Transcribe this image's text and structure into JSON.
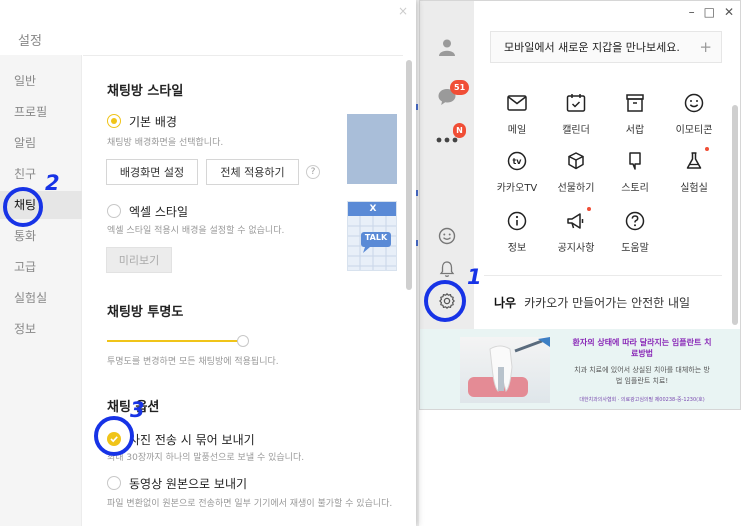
{
  "kakao": {
    "window_controls": [
      "–",
      "□",
      "✕"
    ],
    "sidebar": {
      "chat_badge": "51",
      "more_badge": "N"
    },
    "notice": "모바일에서 새로운 지갑을 만나보세요.",
    "notice_plus": "+",
    "grid": [
      {
        "label": "메일",
        "icon": "mail-icon"
      },
      {
        "label": "캘린더",
        "icon": "calendar-icon"
      },
      {
        "label": "서랍",
        "icon": "drawer-icon"
      },
      {
        "label": "이모티콘",
        "icon": "emoticon-icon"
      },
      {
        "label": "카카오TV",
        "icon": "tv-icon"
      },
      {
        "label": "선물하기",
        "icon": "gift-icon"
      },
      {
        "label": "스토리",
        "icon": "story-icon"
      },
      {
        "label": "실험실",
        "icon": "flask-icon"
      },
      {
        "label": "정보",
        "icon": "info-icon"
      },
      {
        "label": "공지사항",
        "icon": "megaphone-icon"
      },
      {
        "label": "도움말",
        "icon": "help-icon"
      }
    ],
    "footer_bold": "나우",
    "footer_text": "카카오가 만들어가는 안전한 내일",
    "ad": {
      "title": "환자의 상태에 따라 달라지는 임플란트 치료방법",
      "sub": "치과 치료에 있어서 상실된 치아를 대체하는 방법 임플란트 치료!",
      "small": "대한치과의사협회 · 의료광고심의필 제00238-중-1230(호)"
    }
  },
  "settings": {
    "close": "×",
    "title": "설정",
    "nav": [
      "일반",
      "프로필",
      "알림",
      "친구",
      "채팅",
      "통화",
      "고급",
      "실험실",
      "정보"
    ],
    "style_section": {
      "heading": "채팅방 스타일",
      "basic_label": "기본 배경",
      "basic_desc": "채팅방 배경화면을 선택합니다.",
      "set_bg_button": "배경화면 설정",
      "apply_all_button": "전체 적용하기",
      "help": "?",
      "excel_label": "엑셀 스타일",
      "excel_desc": "엑셀 스타일 적용시 배경을 설정할 수 없습니다.",
      "preview_button": "미리보기",
      "excel_preview_text": "TALK",
      "excel_preview_x": "X"
    },
    "transparency_section": {
      "heading": "채팅방 투명도",
      "desc": "투명도를 변경하면 모든 채팅방에 적용됩니다.",
      "level": 0.85
    },
    "options_section": {
      "heading": "채팅 옵션",
      "bundle_label": "사진 전송 시 묶어 보내기",
      "bundle_desc": "최대 30장까지 하나의 말풍선으로 보낼 수 있습니다.",
      "original_label": "동영상 원본으로 보내기",
      "original_desc": "파일 변환없이 원본으로 전송하면 일부 기기에서 재생이 불가할 수 있습니다."
    }
  },
  "annotations": {
    "one": "1",
    "two": "2",
    "three": "3",
    "color": "#1733e6"
  }
}
